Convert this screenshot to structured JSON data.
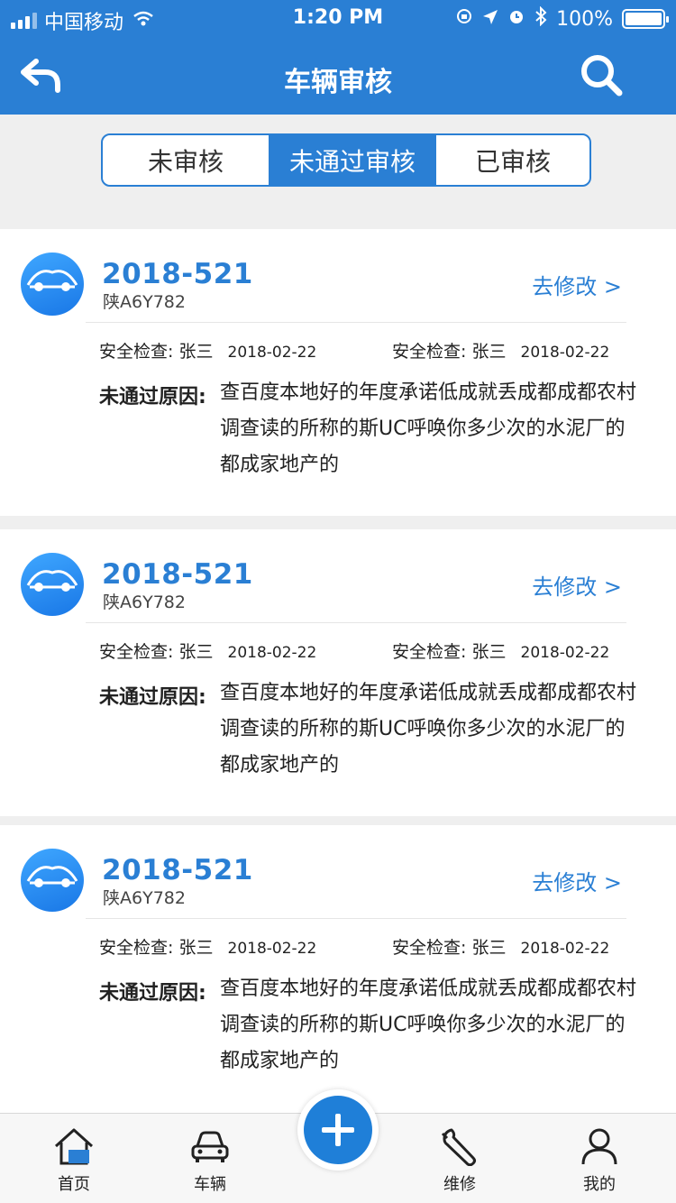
{
  "status": {
    "carrier": "中国移动",
    "time": "1:20 PM",
    "battery": "100%"
  },
  "header": {
    "title": "车辆审核"
  },
  "tabs": [
    {
      "label": "未审核"
    },
    {
      "label": "未通过审核"
    },
    {
      "label": "已审核"
    }
  ],
  "cards": [
    {
      "id": "2018-521",
      "plate": "陕A6Y782",
      "edit": "去修改 >",
      "insp1": {
        "label": "安全检查:",
        "name": "张三",
        "date": "2018-02-22"
      },
      "insp2": {
        "label": "安全检查:",
        "name": "张三",
        "date": "2018-02-22"
      },
      "reason_label": "未通过原因:",
      "reason": "查百度本地好的年度承诺低成就丢成都成都农村调查读的所称的斯UC呼唤你多少次的水泥厂的都成家地产的"
    },
    {
      "id": "2018-521",
      "plate": "陕A6Y782",
      "edit": "去修改 >",
      "insp1": {
        "label": "安全检查:",
        "name": "张三",
        "date": "2018-02-22"
      },
      "insp2": {
        "label": "安全检查:",
        "name": "张三",
        "date": "2018-02-22"
      },
      "reason_label": "未通过原因:",
      "reason": "查百度本地好的年度承诺低成就丢成都成都农村调查读的所称的斯UC呼唤你多少次的水泥厂的都成家地产的"
    },
    {
      "id": "2018-521",
      "plate": "陕A6Y782",
      "edit": "去修改 >",
      "insp1": {
        "label": "安全检查:",
        "name": "张三",
        "date": "2018-02-22"
      },
      "insp2": {
        "label": "安全检查:",
        "name": "张三",
        "date": "2018-02-22"
      },
      "reason_label": "未通过原因:",
      "reason": "查百度本地好的年度承诺低成就丢成都成都农村调查读的所称的斯UC呼唤你多少次的水泥厂的都成家地产的"
    }
  ],
  "nav": [
    {
      "label": "首页",
      "icon": "home-icon"
    },
    {
      "label": "车辆",
      "icon": "car-icon"
    },
    {
      "label": "维修",
      "icon": "wrench-icon"
    },
    {
      "label": "我的",
      "icon": "user-icon"
    }
  ],
  "colors": {
    "primary": "#2a7fd4",
    "background": "#efefef"
  }
}
